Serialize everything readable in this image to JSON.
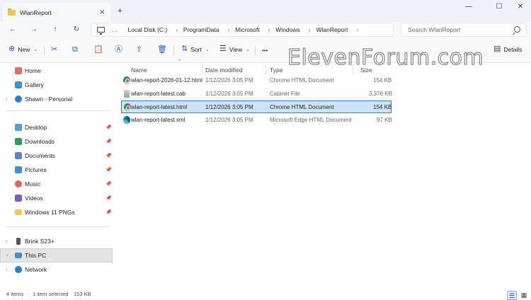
{
  "window": {
    "tab_title": "WlanReport",
    "tab_close": "✕",
    "new_tab": "+",
    "minimize": "—",
    "maximize": "☐",
    "close": "✕"
  },
  "nav": {
    "back": "←",
    "forward": "→",
    "up": "↑",
    "refresh": "↻",
    "overflow": "…",
    "chevron": "›",
    "breadcrumbs": [
      "Local Disk (C:)",
      "ProgramData",
      "Microsoft",
      "Windows",
      "WlanReport"
    ],
    "search_placeholder": "Search WlanReport"
  },
  "toolbar": {
    "new_label": "New",
    "new_icon": "⊕",
    "cut_icon": "✂",
    "copy_icon": "⧉",
    "paste_icon": "📋",
    "rename_icon": "Ⓐ",
    "share_icon": "⇪",
    "delete_icon": "🗑",
    "sort_label": "Sort",
    "sort_icon": "⇅",
    "view_label": "View",
    "view_icon": "☰",
    "more_icon": "•••",
    "details_label": "Details",
    "details_icon": "▤",
    "chevron_down": "⌄"
  },
  "sidebar": {
    "items": [
      {
        "label": "Home",
        "icon": "home-icon",
        "color": "#e26d5a"
      },
      {
        "label": "Gallery",
        "icon": "gallery-icon",
        "color": "#3b8ed8"
      },
      {
        "label": "Shawn - Personal",
        "icon": "onedrive-icon",
        "color": "#2a7fd4"
      },
      {
        "label": "Desktop",
        "icon": "desktop-icon",
        "color": "#4aa3df"
      },
      {
        "label": "Downloads",
        "icon": "downloads-icon",
        "color": "#2f9a5b"
      },
      {
        "label": "Documents",
        "icon": "documents-icon",
        "color": "#5a86c9"
      },
      {
        "label": "Pictures",
        "icon": "pictures-icon",
        "color": "#3f8fd2"
      },
      {
        "label": "Music",
        "icon": "music-icon",
        "color": "#e0674f"
      },
      {
        "label": "Videos",
        "icon": "videos-icon",
        "color": "#7a5ac9"
      },
      {
        "label": "Windows 11 PNGs",
        "icon": "folder-icon",
        "color": "#f7c64b"
      },
      {
        "label": "Brink S23+",
        "icon": "phone-icon",
        "color": "#555555"
      },
      {
        "label": "This PC",
        "icon": "this-pc-icon",
        "color": "#3b8ed8"
      },
      {
        "label": "Network",
        "icon": "network-icon",
        "color": "#2a7fd4"
      }
    ],
    "pin_glyph": "📌",
    "expand_glyph": "›"
  },
  "columns": {
    "name": "Name",
    "date": "Date modified",
    "type": "Type",
    "size": "Size",
    "sort_caret": "⌃"
  },
  "files": [
    {
      "name": "wlan-report-2026-01-12.html",
      "date": "1/12/2026 3:05 PM",
      "type": "Chrome HTML Document",
      "size": "154 KB",
      "icon": "chrome-icon"
    },
    {
      "name": "wlan-report-latest.cab",
      "date": "1/12/2026 3:05 PM",
      "type": "Cabinet File",
      "size": "3,376 KB",
      "icon": "cab-icon"
    },
    {
      "name": "wlan-report-latest.html",
      "date": "1/12/2026 3:05 PM",
      "type": "Chrome HTML Document",
      "size": "154 KB",
      "icon": "chrome-icon"
    },
    {
      "name": "wlan-report-latest.xml",
      "date": "1/12/2026 3:05 PM",
      "type": "Microsoft Edge HTML Document",
      "size": "97 KB",
      "icon": "edge-icon"
    }
  ],
  "watermark": "ElevenForum.com",
  "status": {
    "items": "4 items",
    "selected": "1 item selected",
    "selected_size": "153 KB",
    "details_view_icon": "☰",
    "tiles_view_icon": "▦"
  },
  "colors": {
    "accent": "#3d78c4",
    "selection": "#cce4f7",
    "folder": "#f7c64b"
  }
}
